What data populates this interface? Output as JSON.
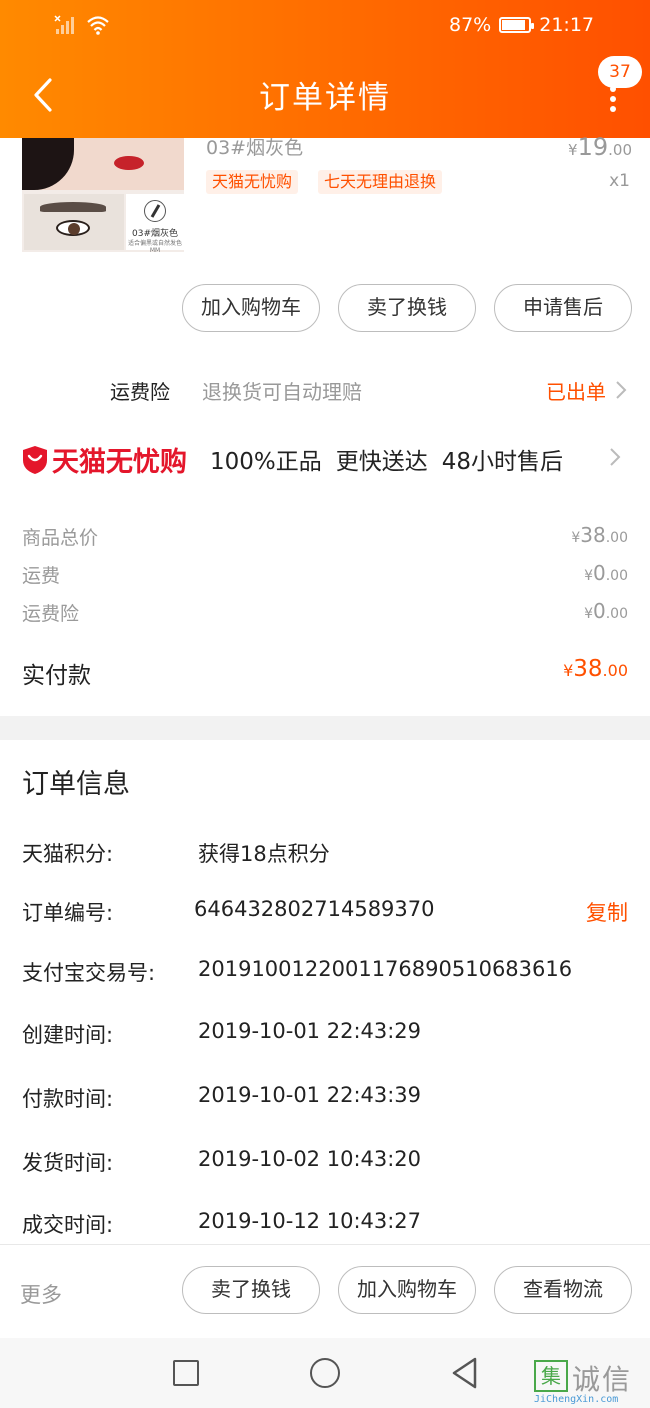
{
  "status_bar": {
    "battery": "87%",
    "battery_level": 0.87,
    "time": "21:17"
  },
  "header": {
    "title": "订单详情",
    "message_count": "37",
    "icons": [
      "back-arrow-icon",
      "more-vertical-icon"
    ]
  },
  "product": {
    "image_caption": "03#烟灰色",
    "image_subcaption": "适合偏黑或自然发色MM",
    "sku": "03#烟灰色",
    "price_currency": "¥",
    "price_int": "19",
    "price_dec": ".00",
    "tags": [
      "天猫无忧购",
      "七天无理由退换"
    ],
    "quantity": "x1"
  },
  "item_actions": [
    "加入购物车",
    "卖了换钱",
    "申请售后"
  ],
  "insurance": {
    "title": "运费险",
    "desc": "退换货可自动理赔",
    "status": "已出单"
  },
  "worry_free": {
    "brand": "天猫无忧购",
    "features": [
      "100%正品",
      "更快送达",
      "48小时售后"
    ]
  },
  "price_summary": [
    {
      "label": "商品总价",
      "currency": "¥",
      "int": "38",
      "dec": ".00"
    },
    {
      "label": "运费",
      "currency": "¥",
      "int": "0",
      "dec": ".00"
    },
    {
      "label": "运费险",
      "currency": "¥",
      "int": "0",
      "dec": ".00"
    }
  ],
  "total": {
    "label": "实付款",
    "currency": "¥",
    "int": "38",
    "dec": ".00"
  },
  "order_info": {
    "title": "订单信息",
    "rows": [
      {
        "label": "天猫积分:",
        "value": "获得18点积分"
      },
      {
        "label": "订单编号:",
        "value": "646432802714589370",
        "action": "复制"
      },
      {
        "label": "支付宝交易号:",
        "value": "2019100122001176890510683616"
      },
      {
        "label": "创建时间:",
        "value": "2019-10-01 22:43:29"
      },
      {
        "label": "付款时间:",
        "value": "2019-10-01 22:43:39"
      },
      {
        "label": "发货时间:",
        "value": "2019-10-02 10:43:20"
      },
      {
        "label": "成交时间:",
        "value": "2019-10-12 10:43:27"
      }
    ]
  },
  "bottom_bar": {
    "more": "更多",
    "buttons": [
      "卖了换钱",
      "加入购物车",
      "查看物流"
    ]
  },
  "watermark": {
    "box_char": "集",
    "text": "诚信",
    "sub": "JiChengXin.com"
  },
  "colors": {
    "brand_orange": "#ff5000",
    "tmall_red": "#e4162b"
  }
}
